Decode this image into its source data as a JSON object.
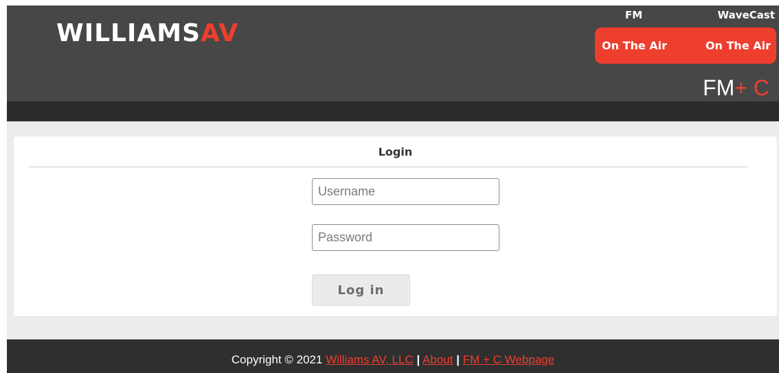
{
  "header": {
    "logo": {
      "text_left": "WILLIAMS",
      "text_right": "AV",
      "icon": "williams-av-logo",
      "brand_color": "#ee3e2e"
    },
    "status": {
      "fm_label": "FM",
      "wavecast_label": "WaveCast",
      "fm_state": "On The Air",
      "wavecast_state": "On The Air",
      "state_color": "#ee3e2e"
    },
    "product": {
      "fm": "FM",
      "plus": "+",
      "c": "C"
    }
  },
  "login": {
    "title": "Login",
    "username_placeholder": "Username",
    "password_placeholder": "Password",
    "submit_label": "Log in"
  },
  "footer": {
    "copyright": "Copyright © 2021",
    "links": [
      {
        "label": "Williams AV, LLC"
      },
      {
        "label": "About"
      },
      {
        "label": "FM + C Webpage"
      }
    ],
    "separator": "|"
  }
}
